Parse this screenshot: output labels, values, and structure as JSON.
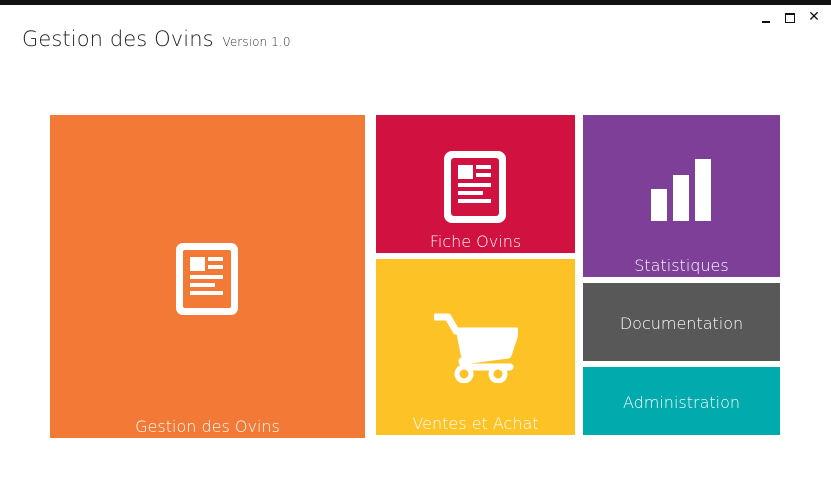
{
  "window": {
    "title": "Gestion des Ovins",
    "version": "Version 1.0",
    "controls": {
      "minimize": "minimize-icon",
      "maximize": "maximize-icon",
      "close": "close-icon"
    }
  },
  "tiles": [
    {
      "id": "gestion",
      "label": "Gestion des Ovins",
      "color": "#f37a36",
      "icon": "document-icon"
    },
    {
      "id": "fiche",
      "label": "Fiche Ovins",
      "color": "#d11241",
      "icon": "document-icon"
    },
    {
      "id": "ventes",
      "label": "Ventes et Achat",
      "color": "#fdc326",
      "icon": "shopping-cart-icon"
    },
    {
      "id": "stats",
      "label": "Statistiques",
      "color": "#7e3f98",
      "icon": "bar-chart-icon"
    },
    {
      "id": "doc",
      "label": "Documentation",
      "color": "#585858"
    },
    {
      "id": "admin",
      "label": "Administration",
      "color": "#00aaad"
    }
  ]
}
